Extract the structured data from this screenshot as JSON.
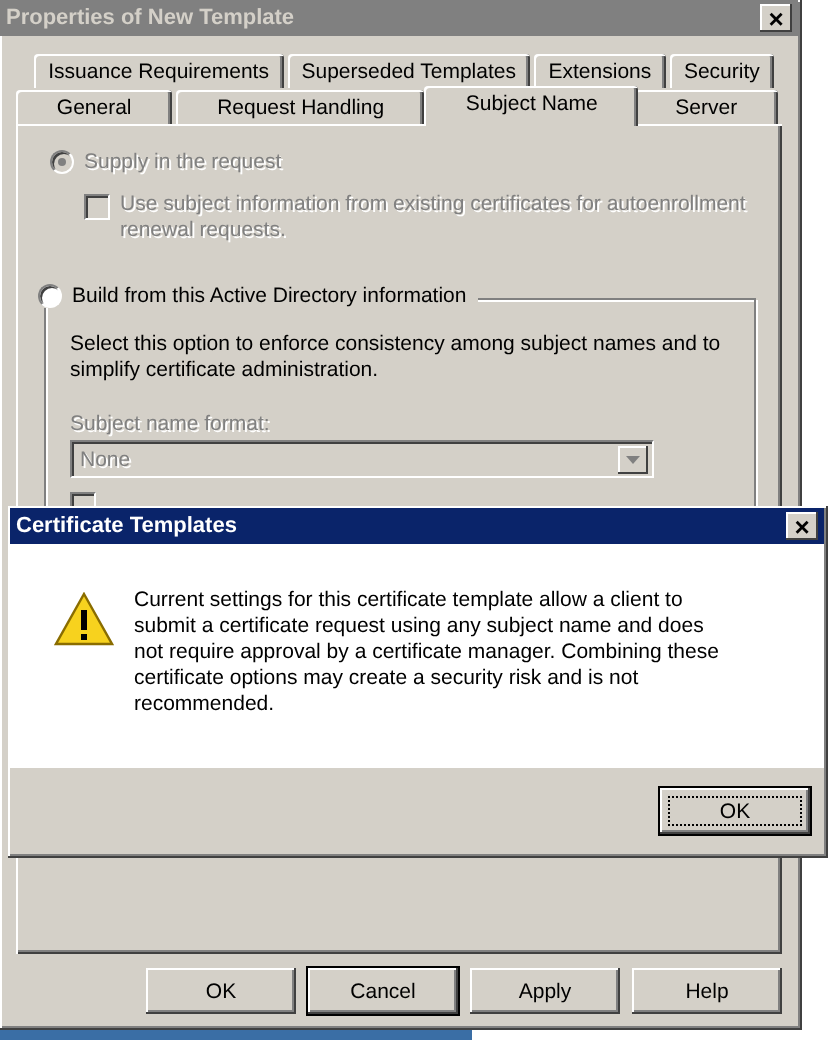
{
  "window": {
    "title": "Properties of New Template",
    "active": false,
    "close": "×"
  },
  "tab_rows": [
    {
      "tabs": [
        {
          "label": "Issuance Requirements",
          "selected": false
        },
        {
          "label": "Superseded Templates",
          "selected": false
        },
        {
          "label": "Extensions",
          "selected": false
        },
        {
          "label": "Security",
          "selected": false
        }
      ]
    },
    {
      "tabs": [
        {
          "label": "General",
          "selected": false
        },
        {
          "label": "Request Handling",
          "selected": false
        },
        {
          "label": "Subject Name",
          "selected": true
        },
        {
          "label": "Server",
          "selected": false
        }
      ]
    }
  ],
  "subject_name": {
    "supply_radio": {
      "label": "Supply in the request",
      "selected": true,
      "disabled": true
    },
    "autoenroll_checkbox": {
      "label": "Use subject information from existing certificates for autoenrollment renewal requests.",
      "checked": false,
      "disabled": true
    },
    "build_radio": {
      "label": "Build from this Active Directory information",
      "selected": false,
      "disabled": false
    },
    "description": "Select this option to enforce consistency among subject names and to simplify certificate administration.",
    "format_label": "Subject name format:",
    "format_select": {
      "value": "None",
      "disabled": true
    },
    "email_checkbox": {
      "disabled": true
    }
  },
  "buttons": [
    {
      "label": "OK",
      "default": false
    },
    {
      "label": "Cancel",
      "default": true
    },
    {
      "label": "Apply",
      "default": false
    },
    {
      "label": "Help",
      "default": false
    }
  ],
  "message_box": {
    "title": "Certificate Templates",
    "active": true,
    "close": "×",
    "text": "Current settings for this certificate template allow a client to submit a certificate request using any subject name and does not require approval by a certificate manager. Combining these certificate options may create a security risk and is not recommended.",
    "buttons": [
      {
        "label": "OK",
        "focused": true
      }
    ]
  }
}
